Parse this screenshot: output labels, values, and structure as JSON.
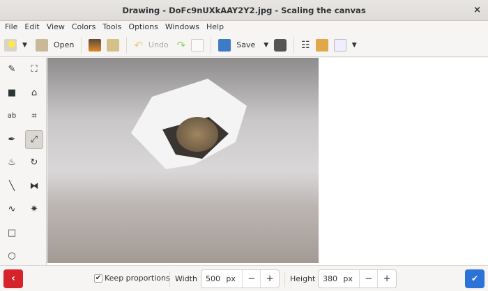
{
  "window": {
    "title": "Drawing - DoFc9nUXkAAY2Y2.jpg - Scaling the canvas",
    "close": "×"
  },
  "menu": [
    "File",
    "Edit",
    "View",
    "Colors",
    "Tools",
    "Options",
    "Windows",
    "Help"
  ],
  "toolbar": {
    "open": "Open",
    "undo": "Undo",
    "save": "Save"
  },
  "tools": [
    {
      "name": "pencil",
      "glyph": "✎"
    },
    {
      "name": "free-shape",
      "glyph": "⛶"
    },
    {
      "name": "rectangle-select",
      "glyph": "■"
    },
    {
      "name": "polygon",
      "glyph": "⌂"
    },
    {
      "name": "text",
      "glyph": "ab"
    },
    {
      "name": "crop",
      "glyph": "⌗"
    },
    {
      "name": "color-picker",
      "glyph": "✒"
    },
    {
      "name": "scale",
      "glyph": "⤢"
    },
    {
      "name": "paint-bucket",
      "glyph": "♨"
    },
    {
      "name": "rotate",
      "glyph": "↻"
    },
    {
      "name": "line",
      "glyph": "╲"
    },
    {
      "name": "flip",
      "glyph": "⧓"
    },
    {
      "name": "curve",
      "glyph": "∿"
    },
    {
      "name": "filters",
      "glyph": "✷"
    },
    {
      "name": "rectangle",
      "glyph": "□"
    },
    {
      "name": "",
      "glyph": ""
    },
    {
      "name": "circle",
      "glyph": "○"
    }
  ],
  "bottom": {
    "keep_proportions": "Keep proportions",
    "keep_checked": true,
    "width_label": "Width",
    "width": "500",
    "height_label": "Height",
    "height": "380",
    "unit": "px",
    "minus": "−",
    "plus": "+",
    "back": "‹",
    "ok": "✔"
  }
}
